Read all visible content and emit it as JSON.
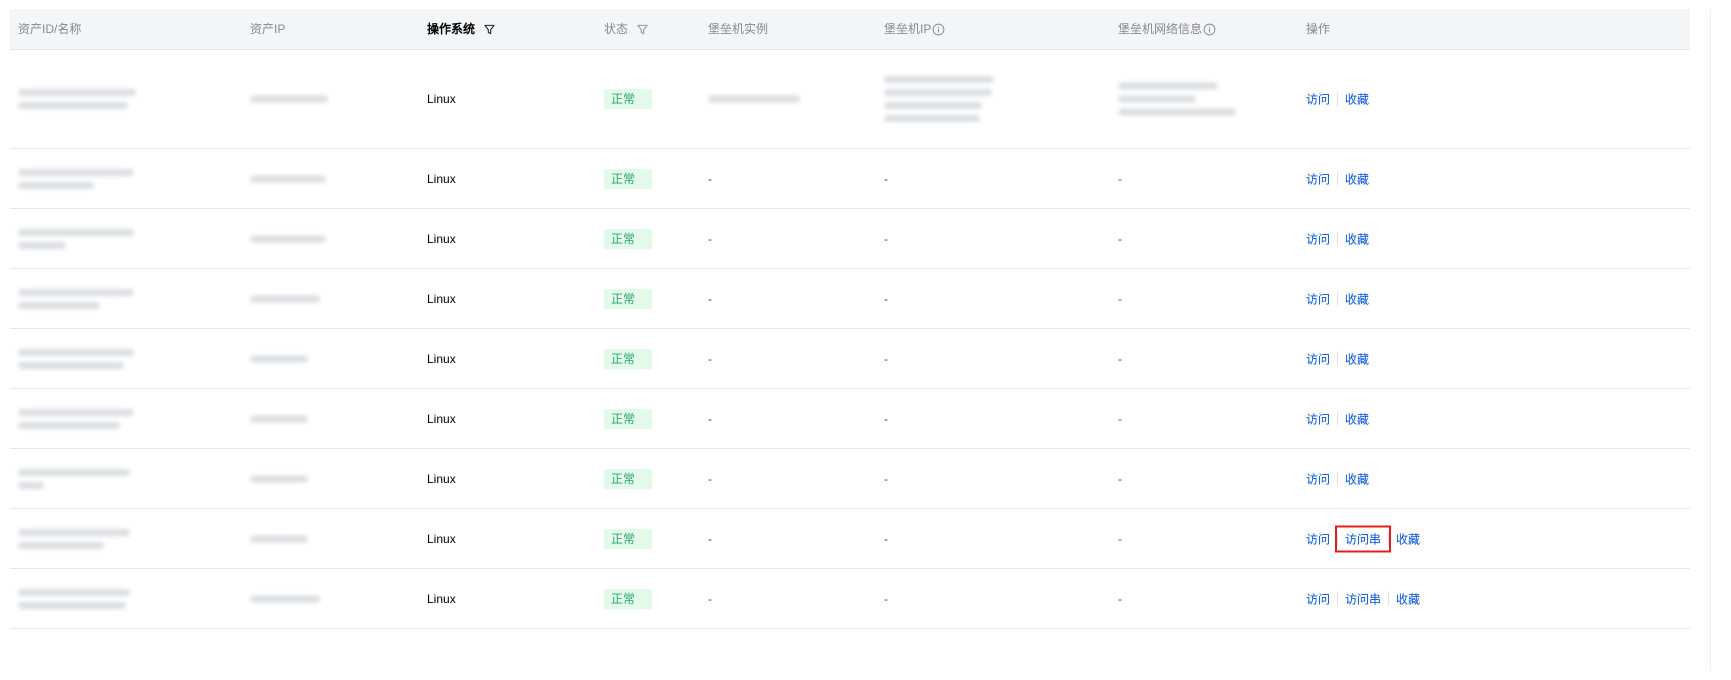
{
  "columns": {
    "asset_id_name": "资产ID/名称",
    "asset_ip": "资产IP",
    "os": "操作系统",
    "status": "状态",
    "bastion_instance": "堡垒机实例",
    "bastion_ip": "堡垒机IP",
    "bastion_network": "堡垒机网络信息",
    "actions": "操作"
  },
  "rows": [
    {
      "os": "Linux",
      "status": "正常",
      "bastion_instance": "",
      "bastion_ip": "",
      "bastion_network": "",
      "actions": [
        "访问",
        "收藏"
      ]
    },
    {
      "os": "Linux",
      "status": "正常",
      "bastion_instance": "-",
      "bastion_ip": "-",
      "bastion_network": "-",
      "actions": [
        "访问",
        "收藏"
      ]
    },
    {
      "os": "Linux",
      "status": "正常",
      "bastion_instance": "-",
      "bastion_ip": "-",
      "bastion_network": "-",
      "actions": [
        "访问",
        "收藏"
      ]
    },
    {
      "os": "Linux",
      "status": "正常",
      "bastion_instance": "-",
      "bastion_ip": "-",
      "bastion_network": "-",
      "actions": [
        "访问",
        "收藏"
      ]
    },
    {
      "os": "Linux",
      "status": "正常",
      "bastion_instance": "-",
      "bastion_ip": "-",
      "bastion_network": "-",
      "actions": [
        "访问",
        "收藏"
      ]
    },
    {
      "os": "Linux",
      "status": "正常",
      "bastion_instance": "-",
      "bastion_ip": "-",
      "bastion_network": "-",
      "actions": [
        "访问",
        "收藏"
      ]
    },
    {
      "os": "Linux",
      "status": "正常",
      "bastion_instance": "-",
      "bastion_ip": "-",
      "bastion_network": "-",
      "actions": [
        "访问",
        "收藏"
      ]
    },
    {
      "os": "Linux",
      "status": "正常",
      "bastion_instance": "-",
      "bastion_ip": "-",
      "bastion_network": "-",
      "actions": [
        "访问",
        "访问串",
        "收藏"
      ]
    },
    {
      "os": "Linux",
      "status": "正常",
      "bastion_instance": "-",
      "bastion_ip": "-",
      "bastion_network": "-",
      "actions": [
        "访问",
        "访问串",
        "收藏"
      ]
    }
  ],
  "colors": {
    "link": "#0052d9",
    "status_ok_text": "#2ba471",
    "status_ok_bg": "#e3f9e9",
    "highlight": "#e02020",
    "header_bg": "#f4f5f7"
  },
  "icons": {
    "filter": "filter-icon",
    "info": "info-circle-icon"
  }
}
